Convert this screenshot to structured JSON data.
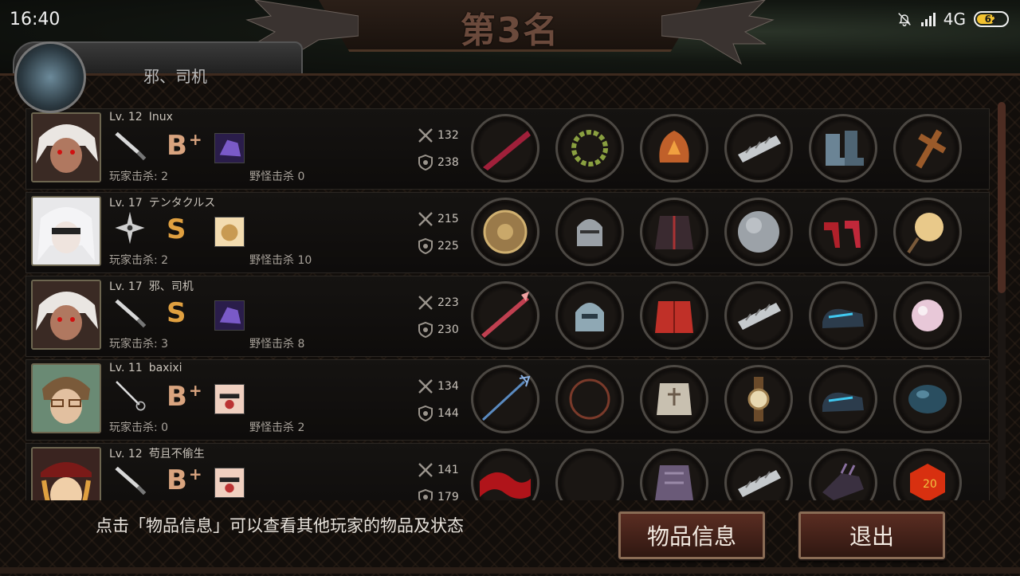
{
  "status_bar": {
    "time": "16:40",
    "network": "4G",
    "battery": "62",
    "battery_level": 0.62
  },
  "title": "第3名",
  "player_tab": {
    "name": "邪、司机"
  },
  "rows": [
    {
      "level": "Lv. 12",
      "name": "Inux",
      "rank": "B",
      "rank_plus": "+",
      "rank_color": "#d9a47f",
      "weapon": "knife-icon",
      "skill": "purple-beast-skill-icon",
      "player_kills": "玩家击杀: 2",
      "monster_kills": "野怪击杀 0",
      "attack": "132",
      "defense": "238",
      "portrait": "white-hair-red-eyes-girl",
      "items": [
        "crimson-blade-icon",
        "laurel-wreath-icon",
        "flaming-armor-icon",
        "metal-bracer-icon",
        "armored-boots-icon",
        "wooden-cross-icon"
      ]
    },
    {
      "level": "Lv. 17",
      "name": "テンタクルス",
      "rank": "S",
      "rank_plus": "",
      "rank_color": "#e0a040",
      "weapon": "shuriken-icon",
      "skill": "golden-fist-skill-icon",
      "player_kills": "玩家击杀: 2",
      "monster_kills": "野怪击杀 10",
      "attack": "215",
      "defense": "225",
      "portrait": "white-hair-blindfold-girl",
      "items": [
        "bronze-shield-icon",
        "knight-helmet-icon",
        "dark-coat-icon",
        "steel-disc-icon",
        "red-heels-icon",
        "hand-mirror-icon"
      ]
    },
    {
      "level": "Lv. 17",
      "name": "邪、司机",
      "rank": "S",
      "rank_plus": "",
      "rank_color": "#e0a040",
      "weapon": "knife-icon",
      "skill": "purple-beast-skill-icon",
      "player_kills": "玩家击杀: 3",
      "monster_kills": "野怪击杀 8",
      "attack": "223",
      "defense": "230",
      "portrait": "white-hair-red-eyes-girl",
      "items": [
        "red-spear-icon",
        "silver-helm-icon",
        "red-jacket-icon",
        "metal-bracer-icon",
        "blue-sneakers-icon",
        "pink-pearl-icon"
      ]
    },
    {
      "level": "Lv. 11",
      "name": "baxixi",
      "rank": "B",
      "rank_plus": "+",
      "rank_color": "#d9a47f",
      "weapon": "rapier-icon",
      "skill": "sunglasses-brawler-skill-icon",
      "player_kills": "玩家击杀: 0",
      "monster_kills": "野怪击杀 2",
      "attack": "134",
      "defense": "144",
      "portrait": "glasses-boy",
      "items": [
        "trident-icon",
        "dark-ring-icon",
        "plate-armor-icon",
        "wristwatch-icon",
        "blue-sneakers-icon",
        "blue-orb-icon"
      ]
    },
    {
      "level": "Lv. 12",
      "name": "苟且不偷生",
      "rank": "B",
      "rank_plus": "+",
      "rank_color": "#d9a47f",
      "weapon": "knife-icon",
      "skill": "sunglasses-brawler-skill-icon",
      "player_kills": "",
      "monster_kills": "",
      "attack": "141",
      "defense": "179",
      "portrait": "red-cap-girl",
      "items": [
        "red-scarf-icon",
        "empty-slot-icon",
        "purple-armor-icon",
        "metal-bracer-icon",
        "purple-gauntlet-icon",
        "orange-dice-icon"
      ]
    }
  ],
  "footer": {
    "hint": "点击「物品信息」可以查看其他玩家的物品及状态",
    "info_button": "物品信息",
    "exit_button": "退出"
  }
}
